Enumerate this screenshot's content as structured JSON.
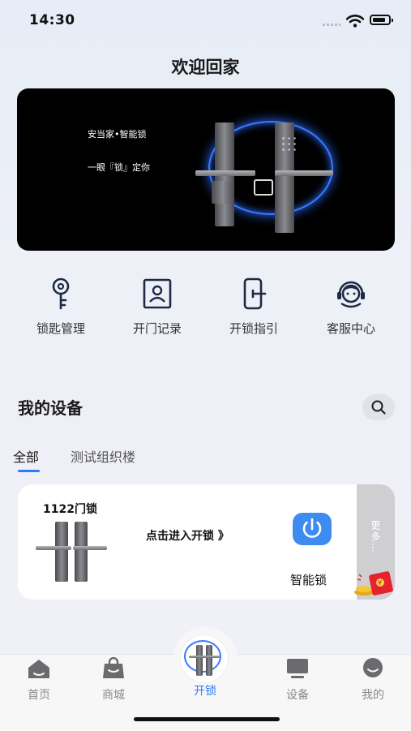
{
  "status_bar": {
    "time": "14:30"
  },
  "header": {
    "title": "欢迎回家"
  },
  "banner": {
    "brand": "安当家•智能锁",
    "slogan": "一眼『锁』定你"
  },
  "quick_nav": [
    {
      "label": "锁匙管理",
      "icon": "key-icon"
    },
    {
      "label": "开门记录",
      "icon": "id-card-icon"
    },
    {
      "label": "开锁指引",
      "icon": "phone-guide-icon"
    },
    {
      "label": "客服中心",
      "icon": "headset-agent-icon"
    }
  ],
  "devices_section": {
    "title": "我的设备",
    "tabs": [
      {
        "label": "全部",
        "active": true
      },
      {
        "label": "测试组织楼",
        "active": false
      }
    ]
  },
  "device_card": {
    "name": "1122门锁",
    "enter_label": "点击进入开锁 》",
    "type": "智能锁",
    "more_label": "更多…"
  },
  "tabbar": {
    "items": [
      {
        "label": "首页",
        "icon": "home-icon"
      },
      {
        "label": "商城",
        "icon": "shop-bag-icon"
      },
      {
        "label": "开锁",
        "icon": "door-lock-icon",
        "active": true
      },
      {
        "label": "设备",
        "icon": "monitor-icon"
      },
      {
        "label": "我的",
        "icon": "profile-icon"
      }
    ]
  },
  "colors": {
    "accent": "#2b7cf7",
    "power_button": "#3e8cf0",
    "inactive_tab": "#8a8a8e"
  }
}
